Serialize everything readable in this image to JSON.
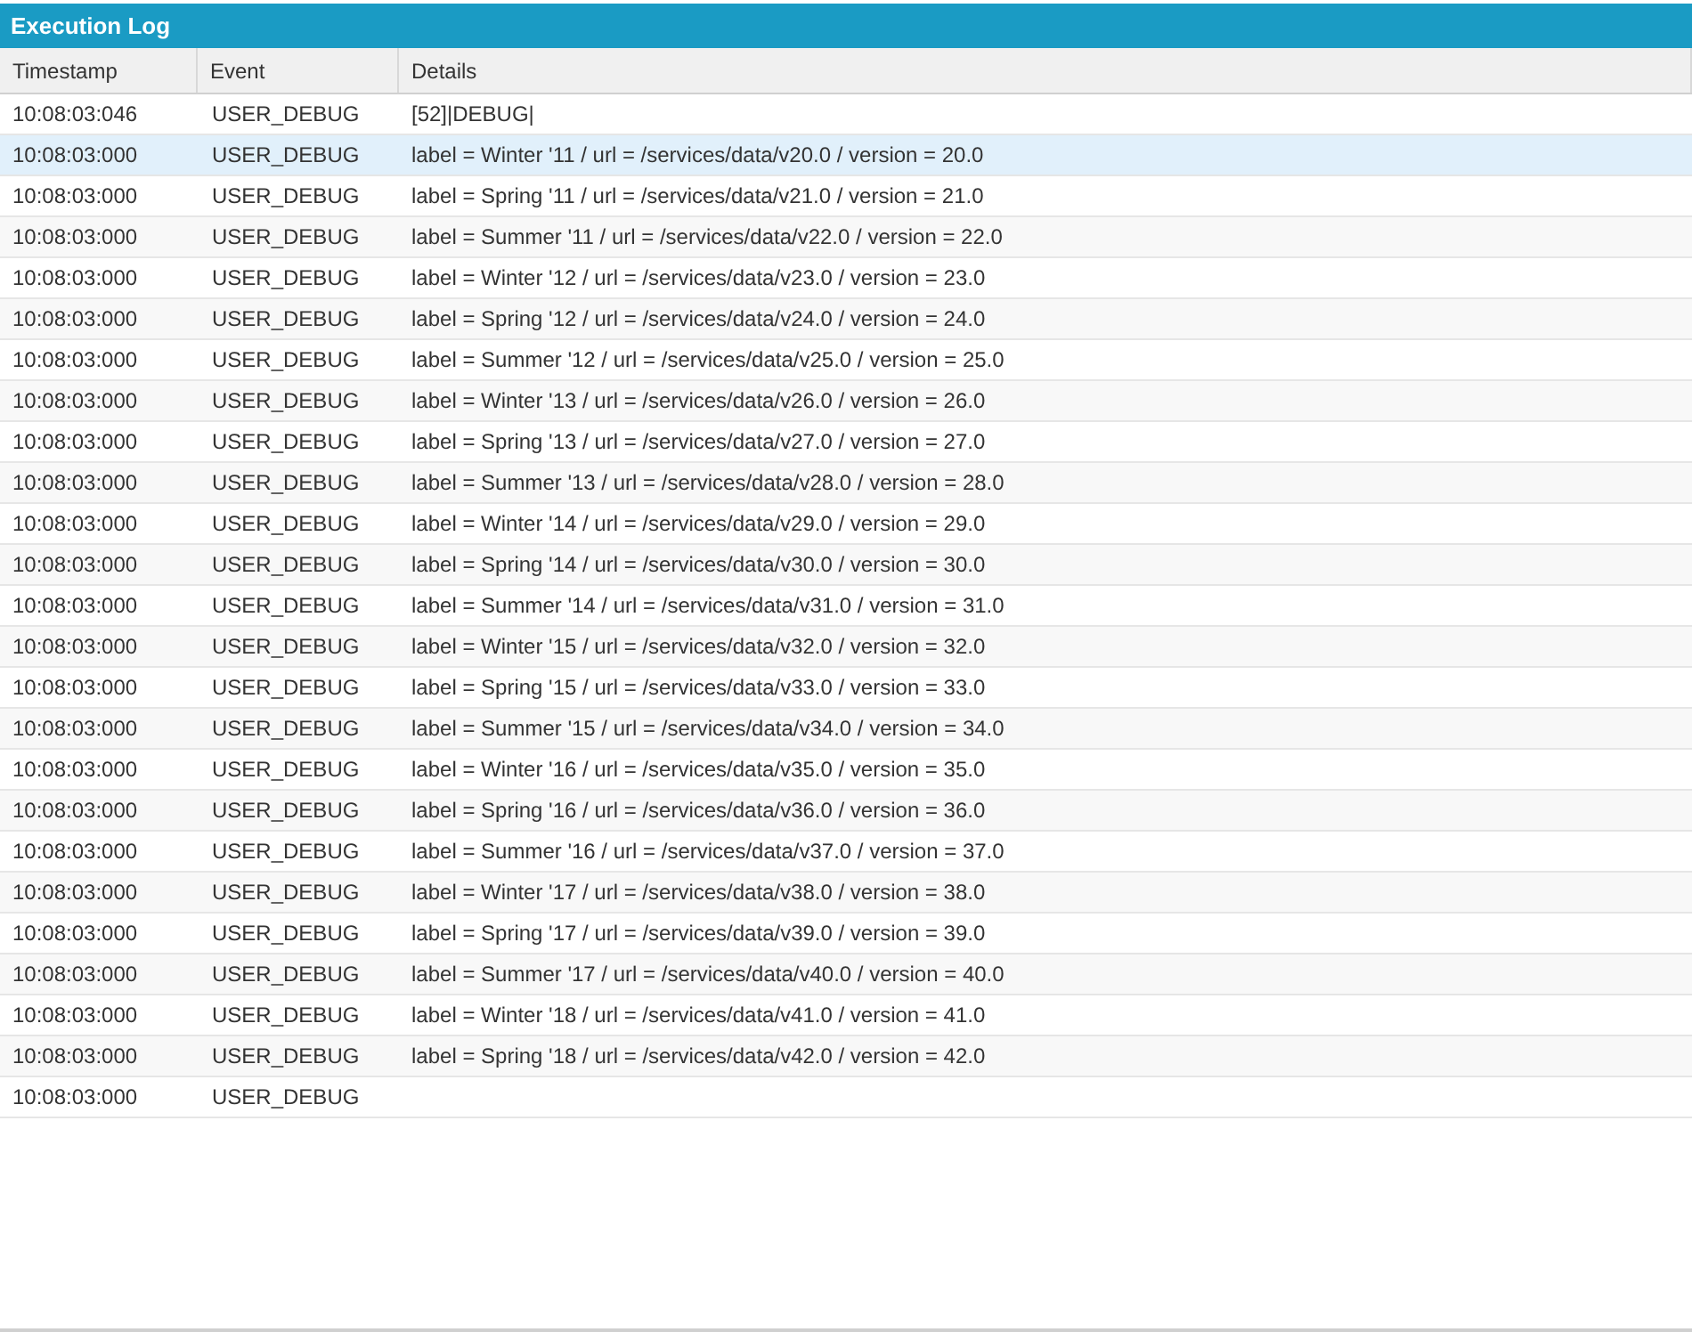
{
  "panel": {
    "title": "Execution Log"
  },
  "table": {
    "columns": [
      "Timestamp",
      "Event",
      "Details"
    ],
    "rows": [
      {
        "timestamp": "10:08:03:046",
        "event": "USER_DEBUG",
        "details": "[52]|DEBUG|",
        "selected": false
      },
      {
        "timestamp": "10:08:03:000",
        "event": "USER_DEBUG",
        "details": "label = Winter '11 / url = /services/data/v20.0 / version = 20.0",
        "selected": true
      },
      {
        "timestamp": "10:08:03:000",
        "event": "USER_DEBUG",
        "details": "label = Spring '11 / url = /services/data/v21.0 / version = 21.0",
        "selected": false
      },
      {
        "timestamp": "10:08:03:000",
        "event": "USER_DEBUG",
        "details": "label = Summer '11 / url = /services/data/v22.0 / version = 22.0",
        "selected": false
      },
      {
        "timestamp": "10:08:03:000",
        "event": "USER_DEBUG",
        "details": "label = Winter '12 / url = /services/data/v23.0 / version = 23.0",
        "selected": false
      },
      {
        "timestamp": "10:08:03:000",
        "event": "USER_DEBUG",
        "details": "label = Spring '12 / url = /services/data/v24.0 / version = 24.0",
        "selected": false
      },
      {
        "timestamp": "10:08:03:000",
        "event": "USER_DEBUG",
        "details": "label = Summer '12 / url = /services/data/v25.0 / version = 25.0",
        "selected": false
      },
      {
        "timestamp": "10:08:03:000",
        "event": "USER_DEBUG",
        "details": "label = Winter '13 / url = /services/data/v26.0 / version = 26.0",
        "selected": false
      },
      {
        "timestamp": "10:08:03:000",
        "event": "USER_DEBUG",
        "details": "label = Spring '13 / url = /services/data/v27.0 / version = 27.0",
        "selected": false
      },
      {
        "timestamp": "10:08:03:000",
        "event": "USER_DEBUG",
        "details": "label = Summer '13 / url = /services/data/v28.0 / version = 28.0",
        "selected": false
      },
      {
        "timestamp": "10:08:03:000",
        "event": "USER_DEBUG",
        "details": "label = Winter '14 / url = /services/data/v29.0 / version = 29.0",
        "selected": false
      },
      {
        "timestamp": "10:08:03:000",
        "event": "USER_DEBUG",
        "details": "label = Spring '14 / url = /services/data/v30.0 / version = 30.0",
        "selected": false
      },
      {
        "timestamp": "10:08:03:000",
        "event": "USER_DEBUG",
        "details": "label = Summer '14 / url = /services/data/v31.0 / version = 31.0",
        "selected": false
      },
      {
        "timestamp": "10:08:03:000",
        "event": "USER_DEBUG",
        "details": "label = Winter '15 / url = /services/data/v32.0 / version = 32.0",
        "selected": false
      },
      {
        "timestamp": "10:08:03:000",
        "event": "USER_DEBUG",
        "details": "label = Spring '15 / url = /services/data/v33.0 / version = 33.0",
        "selected": false
      },
      {
        "timestamp": "10:08:03:000",
        "event": "USER_DEBUG",
        "details": "label = Summer '15 / url = /services/data/v34.0 / version = 34.0",
        "selected": false
      },
      {
        "timestamp": "10:08:03:000",
        "event": "USER_DEBUG",
        "details": "label = Winter '16 / url = /services/data/v35.0 / version = 35.0",
        "selected": false
      },
      {
        "timestamp": "10:08:03:000",
        "event": "USER_DEBUG",
        "details": "label = Spring '16 / url = /services/data/v36.0 / version = 36.0",
        "selected": false
      },
      {
        "timestamp": "10:08:03:000",
        "event": "USER_DEBUG",
        "details": "label = Summer '16 / url = /services/data/v37.0 / version = 37.0",
        "selected": false
      },
      {
        "timestamp": "10:08:03:000",
        "event": "USER_DEBUG",
        "details": "label = Winter '17 / url = /services/data/v38.0 / version = 38.0",
        "selected": false
      },
      {
        "timestamp": "10:08:03:000",
        "event": "USER_DEBUG",
        "details": "label = Spring '17 / url = /services/data/v39.0 / version = 39.0",
        "selected": false
      },
      {
        "timestamp": "10:08:03:000",
        "event": "USER_DEBUG",
        "details": "label = Summer '17 / url = /services/data/v40.0 / version = 40.0",
        "selected": false
      },
      {
        "timestamp": "10:08:03:000",
        "event": "USER_DEBUG",
        "details": "label = Winter '18 / url = /services/data/v41.0 / version = 41.0",
        "selected": false
      },
      {
        "timestamp": "10:08:03:000",
        "event": "USER_DEBUG",
        "details": "label = Spring '18 / url = /services/data/v42.0 / version = 42.0",
        "selected": false
      },
      {
        "timestamp": "10:08:03:000",
        "event": "USER_DEBUG",
        "selected": false
      }
    ]
  }
}
